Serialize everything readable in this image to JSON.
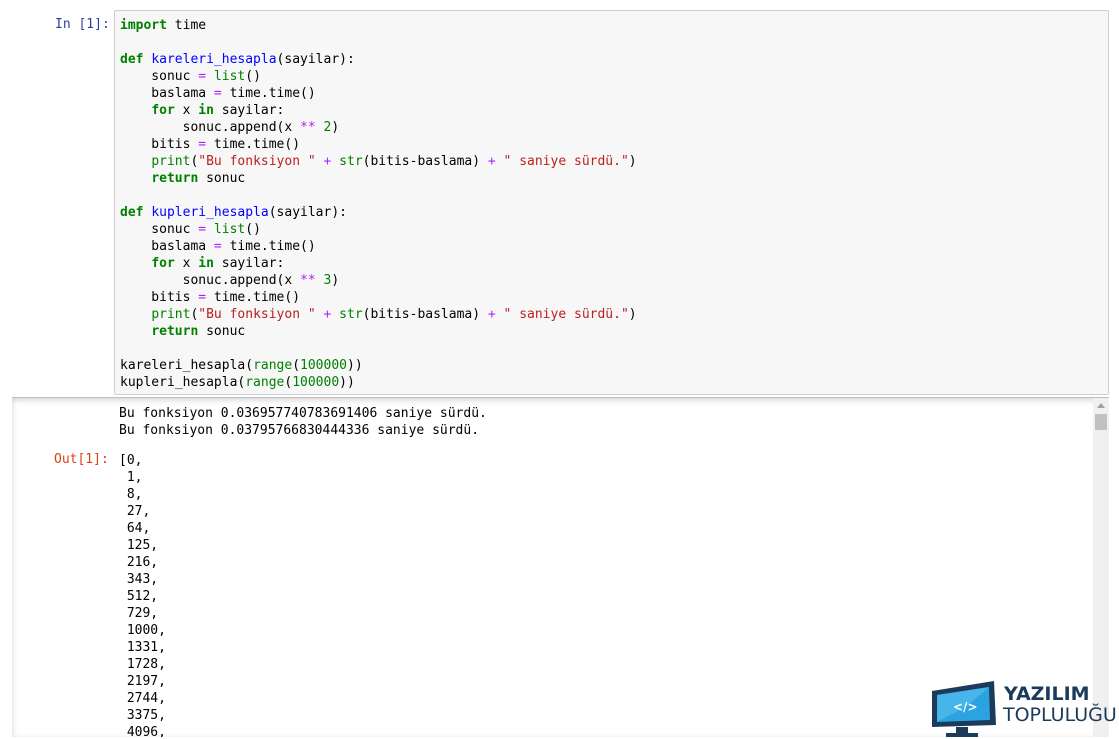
{
  "input_cell": {
    "prompt": "In [1]:",
    "code_lines": [
      "import time",
      "",
      "def kareleri_hesapla(sayilar):",
      "    sonuc = list()",
      "    baslama = time.time()",
      "    for x in sayilar:",
      "        sonuc.append(x ** 2)",
      "    bitis = time.time()",
      "    print(\"Bu fonksiyon \" + str(bitis-baslama) + \" saniye sürdü.\")",
      "    return sonuc",
      "",
      "def kupleri_hesapla(sayilar):",
      "    sonuc = list()",
      "    baslama = time.time()",
      "    for x in sayilar:",
      "        sonuc.append(x ** 3)",
      "    bitis = time.time()",
      "    print(\"Bu fonksiyon \" + str(bitis-baslama) + \" saniye sürdü.\")",
      "    return sonuc",
      "",
      "kareleri_hesapla(range(100000))",
      "kupleri_hesapla(range(100000))"
    ]
  },
  "output_cell": {
    "stream_lines": [
      "Bu fonksiyon 0.036957740783691406 saniye sürdü.",
      "Bu fonksiyon 0.03795766830444336 saniye sürdü."
    ],
    "prompt": "Out[1]:",
    "result_lines": [
      "[0,",
      " 1,",
      " 8,",
      " 27,",
      " 64,",
      " 125,",
      " 216,",
      " 343,",
      " 512,",
      " 729,",
      " 1000,",
      " 1331,",
      " 1728,",
      " 2197,",
      " 2744,",
      " 3375,",
      " 4096,"
    ]
  },
  "watermark": {
    "line1": "YAZILIM",
    "line2": "TOPLULUĞU",
    "icon": "monitor-logo-icon"
  },
  "colors": {
    "prompt_in": "#303F9F",
    "prompt_out": "#D84315",
    "keyword": "#008000",
    "string": "#BA2121",
    "operator": "#AA22FF"
  }
}
